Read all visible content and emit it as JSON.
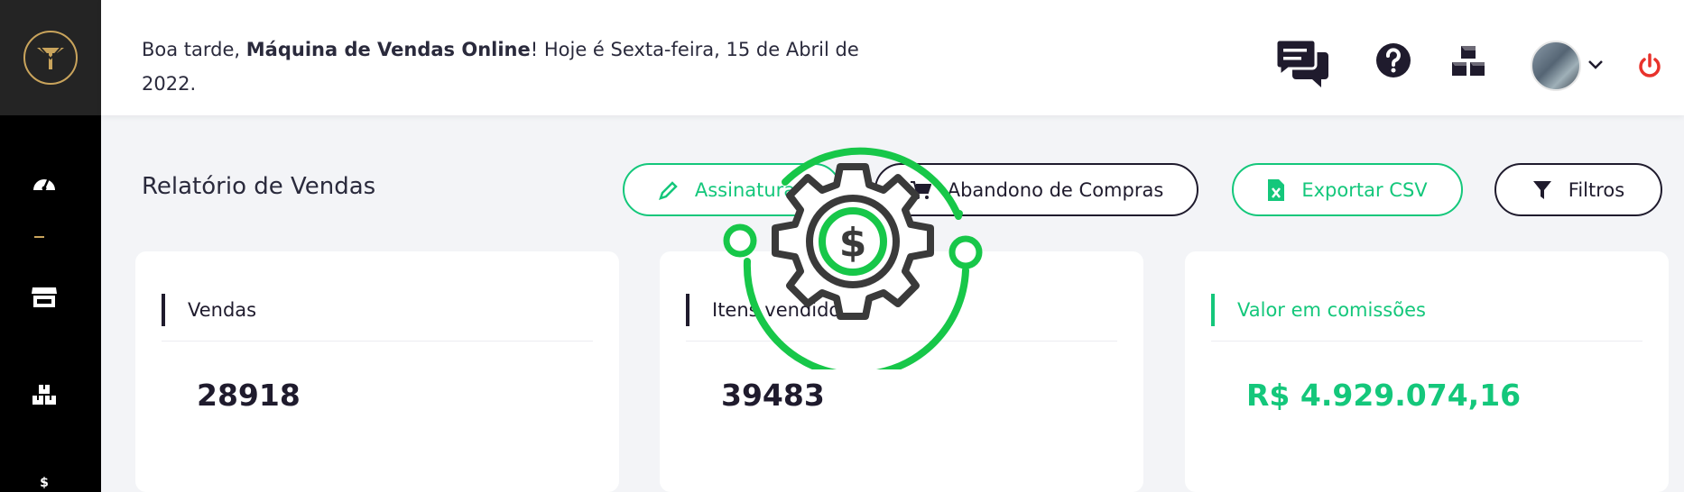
{
  "greeting": {
    "prefix": "Boa tarde, ",
    "name": "Máquina de Vendas Online",
    "suffix_line1": "! Hoje é Sexta-feira, 15 de Abril de",
    "suffix_line2": "2022."
  },
  "page": {
    "title": "Relatório de Vendas"
  },
  "actions": {
    "assinaturas": "Assinaturas",
    "abandono": "Abandono de Compras",
    "exportar": "Exportar CSV",
    "filtros": "Filtros"
  },
  "cards": {
    "vendas_label": "Vendas",
    "vendas_value": "28918",
    "itens_label": "Itens vendidos",
    "itens_value": "39483",
    "comissoes_label": "Valor em comissões",
    "comissoes_value": "R$ 4.929.074,16"
  },
  "sidebar": {
    "icons": [
      "dashboard-icon",
      "store-icon",
      "boxes-icon",
      "dollar-icon"
    ],
    "dollar_glyph": "$"
  },
  "topbar_icons": [
    "chat-icon",
    "help-icon",
    "boxes-icon",
    "chevron-down-icon",
    "power-icon"
  ],
  "colors": {
    "accent_green": "#14c77b",
    "dark": "#1f1b2d",
    "gold": "#c9a45c",
    "power_red": "#e8322b"
  }
}
